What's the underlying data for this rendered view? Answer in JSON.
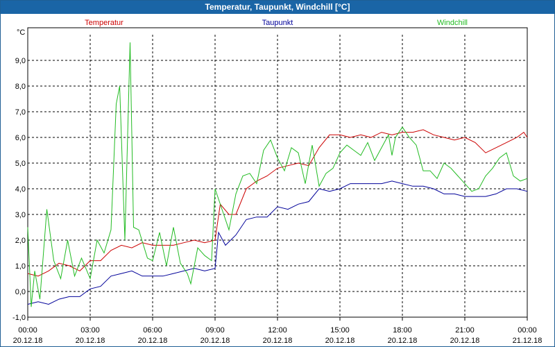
{
  "window": {
    "title": "Temperatur, Taupunkt, Windchill [°C]"
  },
  "chart_data": {
    "type": "line",
    "title": "Temperatur, Taupunkt, Windchill [°C]",
    "ylabel": "°C",
    "ylim": [
      -1.0,
      10.0
    ],
    "yticks": [
      "-1,0",
      "0,0",
      "1,0",
      "2,0",
      "3,0",
      "4,0",
      "5,0",
      "6,0",
      "7,0",
      "8,0",
      "9,0"
    ],
    "xlim": [
      "20.12.18 00:00",
      "21.12.18 00:00"
    ],
    "xticks": [
      {
        "time": "00:00",
        "date": "20.12.18"
      },
      {
        "time": "03:00",
        "date": "20.12.18"
      },
      {
        "time": "06:00",
        "date": "20.12.18"
      },
      {
        "time": "09:00",
        "date": "20.12.18"
      },
      {
        "time": "12:00",
        "date": "20.12.18"
      },
      {
        "time": "15:00",
        "date": "20.12.18"
      },
      {
        "time": "18:00",
        "date": "20.12.18"
      },
      {
        "time": "21:00",
        "date": "20.12.18"
      },
      {
        "time": "00:00",
        "date": "21.12.18"
      }
    ],
    "grid": true,
    "series": [
      {
        "name": "Temperatur",
        "color": "#cc0000",
        "points": [
          [
            "20.12.18 00:00",
            0.7
          ],
          [
            "20.12.18 00:30",
            0.6
          ],
          [
            "20.12.18 01:00",
            0.8
          ],
          [
            "20.12.18 01:30",
            1.1
          ],
          [
            "20.12.18 02:00",
            1.0
          ],
          [
            "20.12.18 02:30",
            0.8
          ],
          [
            "20.12.18 03:00",
            1.2
          ],
          [
            "20.12.18 03:30",
            1.2
          ],
          [
            "20.12.18 04:00",
            1.6
          ],
          [
            "20.12.18 04:30",
            1.8
          ],
          [
            "20.12.18 05:00",
            1.7
          ],
          [
            "20.12.18 05:30",
            1.9
          ],
          [
            "20.12.18 06:00",
            1.8
          ],
          [
            "20.12.18 06:30",
            1.8
          ],
          [
            "20.12.18 07:00",
            1.8
          ],
          [
            "20.12.18 07:30",
            1.9
          ],
          [
            "20.12.18 08:00",
            2.0
          ],
          [
            "20.12.18 08:30",
            1.9
          ],
          [
            "20.12.18 09:00",
            2.0
          ],
          [
            "20.12.18 09:15",
            3.4
          ],
          [
            "20.12.18 09:40",
            3.0
          ],
          [
            "20.12.18 10:00",
            3.0
          ],
          [
            "20.12.18 10:30",
            4.0
          ],
          [
            "20.12.18 11:00",
            4.3
          ],
          [
            "20.12.18 11:30",
            4.5
          ],
          [
            "20.12.18 12:00",
            4.8
          ],
          [
            "20.12.18 12:30",
            4.9
          ],
          [
            "20.12.18 13:00",
            5.0
          ],
          [
            "20.12.18 13:30",
            4.9
          ],
          [
            "20.12.18 14:00",
            5.6
          ],
          [
            "20.12.18 14:30",
            6.1
          ],
          [
            "20.12.18 15:00",
            6.1
          ],
          [
            "20.12.18 15:30",
            6.0
          ],
          [
            "20.12.18 16:00",
            6.1
          ],
          [
            "20.12.18 16:30",
            6.0
          ],
          [
            "20.12.18 17:00",
            6.2
          ],
          [
            "20.12.18 17:30",
            6.1
          ],
          [
            "20.12.18 18:00",
            6.2
          ],
          [
            "20.12.18 18:30",
            6.2
          ],
          [
            "20.12.18 19:00",
            6.3
          ],
          [
            "20.12.18 19:30",
            6.1
          ],
          [
            "20.12.18 20:00",
            6.0
          ],
          [
            "20.12.18 20:30",
            5.9
          ],
          [
            "20.12.18 21:00",
            6.0
          ],
          [
            "20.12.18 21:30",
            5.8
          ],
          [
            "20.12.18 22:00",
            5.4
          ],
          [
            "20.12.18 22:30",
            5.6
          ],
          [
            "20.12.18 23:00",
            5.8
          ],
          [
            "20.12.18 23:30",
            6.0
          ],
          [
            "20.12.18 23:50",
            6.2
          ],
          [
            "21.12.18 00:00",
            6.0
          ]
        ]
      },
      {
        "name": "Taupunkt",
        "color": "#000099",
        "points": [
          [
            "20.12.18 00:00",
            -0.5
          ],
          [
            "20.12.18 00:30",
            -0.4
          ],
          [
            "20.12.18 01:00",
            -0.5
          ],
          [
            "20.12.18 01:30",
            -0.3
          ],
          [
            "20.12.18 02:00",
            -0.2
          ],
          [
            "20.12.18 02:30",
            -0.2
          ],
          [
            "20.12.18 03:00",
            0.1
          ],
          [
            "20.12.18 03:30",
            0.2
          ],
          [
            "20.12.18 04:00",
            0.6
          ],
          [
            "20.12.18 04:30",
            0.7
          ],
          [
            "20.12.18 05:00",
            0.8
          ],
          [
            "20.12.18 05:30",
            0.6
          ],
          [
            "20.12.18 06:00",
            0.6
          ],
          [
            "20.12.18 06:30",
            0.6
          ],
          [
            "20.12.18 07:00",
            0.7
          ],
          [
            "20.12.18 07:30",
            0.8
          ],
          [
            "20.12.18 08:00",
            0.9
          ],
          [
            "20.12.18 08:30",
            0.8
          ],
          [
            "20.12.18 09:00",
            0.9
          ],
          [
            "20.12.18 09:10",
            2.3
          ],
          [
            "20.12.18 09:30",
            1.8
          ],
          [
            "20.12.18 10:00",
            2.2
          ],
          [
            "20.12.18 10:30",
            2.8
          ],
          [
            "20.12.18 11:00",
            2.9
          ],
          [
            "20.12.18 11:30",
            2.9
          ],
          [
            "20.12.18 12:00",
            3.3
          ],
          [
            "20.12.18 12:30",
            3.2
          ],
          [
            "20.12.18 13:00",
            3.4
          ],
          [
            "20.12.18 13:30",
            3.5
          ],
          [
            "20.12.18 14:00",
            4.0
          ],
          [
            "20.12.18 14:30",
            3.9
          ],
          [
            "20.12.18 15:00",
            4.0
          ],
          [
            "20.12.18 15:30",
            4.2
          ],
          [
            "20.12.18 16:00",
            4.2
          ],
          [
            "20.12.18 16:30",
            4.2
          ],
          [
            "20.12.18 17:00",
            4.2
          ],
          [
            "20.12.18 17:30",
            4.3
          ],
          [
            "20.12.18 18:00",
            4.2
          ],
          [
            "20.12.18 18:30",
            4.1
          ],
          [
            "20.12.18 19:00",
            4.1
          ],
          [
            "20.12.18 19:30",
            4.0
          ],
          [
            "20.12.18 20:00",
            3.8
          ],
          [
            "20.12.18 20:30",
            3.8
          ],
          [
            "20.12.18 21:00",
            3.7
          ],
          [
            "20.12.18 21:30",
            3.7
          ],
          [
            "20.12.18 22:00",
            3.7
          ],
          [
            "20.12.18 22:30",
            3.8
          ],
          [
            "20.12.18 23:00",
            4.0
          ],
          [
            "20.12.18 23:30",
            4.0
          ],
          [
            "21.12.18 00:00",
            3.9
          ]
        ]
      },
      {
        "name": "Windchill",
        "color": "#22bb22",
        "points": [
          [
            "20.12.18 00:00",
            2.5
          ],
          [
            "20.12.18 00:10",
            -0.6
          ],
          [
            "20.12.18 00:20",
            0.8
          ],
          [
            "20.12.18 00:35",
            -0.3
          ],
          [
            "20.12.18 00:55",
            3.2
          ],
          [
            "20.12.18 01:15",
            1.2
          ],
          [
            "20.12.18 01:35",
            0.5
          ],
          [
            "20.12.18 01:55",
            2.0
          ],
          [
            "20.12.18 02:15",
            0.6
          ],
          [
            "20.12.18 02:35",
            1.3
          ],
          [
            "20.12.18 03:00",
            0.5
          ],
          [
            "20.12.18 03:20",
            2.0
          ],
          [
            "20.12.18 03:40",
            1.5
          ],
          [
            "20.12.18 04:00",
            2.4
          ],
          [
            "20.12.18 04:15",
            7.3
          ],
          [
            "20.12.18 04:25",
            8.0
          ],
          [
            "20.12.18 04:40",
            2.0
          ],
          [
            "20.12.18 04:55",
            9.7
          ],
          [
            "20.12.18 05:05",
            2.5
          ],
          [
            "20.12.18 05:20",
            2.4
          ],
          [
            "20.12.18 05:45",
            1.3
          ],
          [
            "20.12.18 06:00",
            1.2
          ],
          [
            "20.12.18 06:20",
            2.3
          ],
          [
            "20.12.18 06:40",
            1.0
          ],
          [
            "20.12.18 07:00",
            2.5
          ],
          [
            "20.12.18 07:20",
            1.1
          ],
          [
            "20.12.18 07:40",
            0.7
          ],
          [
            "20.12.18 07:50",
            0.3
          ],
          [
            "20.12.18 08:10",
            1.7
          ],
          [
            "20.12.18 08:30",
            1.4
          ],
          [
            "20.12.18 08:50",
            1.2
          ],
          [
            "20.12.18 09:00",
            4.0
          ],
          [
            "20.12.18 09:20",
            3.2
          ],
          [
            "20.12.18 09:40",
            2.4
          ],
          [
            "20.12.18 10:00",
            3.8
          ],
          [
            "20.12.18 10:20",
            4.5
          ],
          [
            "20.12.18 10:40",
            4.6
          ],
          [
            "20.12.18 11:00",
            4.2
          ],
          [
            "20.12.18 11:20",
            5.5
          ],
          [
            "20.12.18 11:40",
            5.9
          ],
          [
            "20.12.18 12:00",
            5.2
          ],
          [
            "20.12.18 12:20",
            4.7
          ],
          [
            "20.12.18 12:40",
            5.6
          ],
          [
            "20.12.18 13:00",
            5.4
          ],
          [
            "20.12.18 13:20",
            4.2
          ],
          [
            "20.12.18 13:40",
            5.7
          ],
          [
            "20.12.18 14:00",
            4.1
          ],
          [
            "20.12.18 14:20",
            4.6
          ],
          [
            "20.12.18 14:40",
            4.8
          ],
          [
            "20.12.18 15:00",
            5.4
          ],
          [
            "20.12.18 15:20",
            5.7
          ],
          [
            "20.12.18 15:40",
            5.5
          ],
          [
            "20.12.18 16:00",
            5.3
          ],
          [
            "20.12.18 16:20",
            5.8
          ],
          [
            "20.12.18 16:40",
            5.1
          ],
          [
            "20.12.18 17:00",
            5.6
          ],
          [
            "20.12.18 17:20",
            6.1
          ],
          [
            "20.12.18 17:30",
            5.3
          ],
          [
            "20.12.18 17:40",
            6.0
          ],
          [
            "20.12.18 18:00",
            6.4
          ],
          [
            "20.12.18 18:20",
            6.0
          ],
          [
            "20.12.18 18:40",
            5.7
          ],
          [
            "20.12.18 19:00",
            4.7
          ],
          [
            "20.12.18 19:20",
            4.7
          ],
          [
            "20.12.18 19:40",
            4.4
          ],
          [
            "20.12.18 20:00",
            5.0
          ],
          [
            "20.12.18 20:20",
            4.8
          ],
          [
            "20.12.18 20:40",
            4.5
          ],
          [
            "20.12.18 21:00",
            4.2
          ],
          [
            "20.12.18 21:20",
            3.9
          ],
          [
            "20.12.18 21:40",
            4.0
          ],
          [
            "20.12.18 22:00",
            4.5
          ],
          [
            "20.12.18 22:20",
            4.8
          ],
          [
            "20.12.18 22:40",
            5.2
          ],
          [
            "20.12.18 23:00",
            5.4
          ],
          [
            "20.12.18 23:20",
            4.5
          ],
          [
            "20.12.18 23:40",
            4.3
          ],
          [
            "21.12.18 00:00",
            4.4
          ]
        ]
      }
    ]
  }
}
